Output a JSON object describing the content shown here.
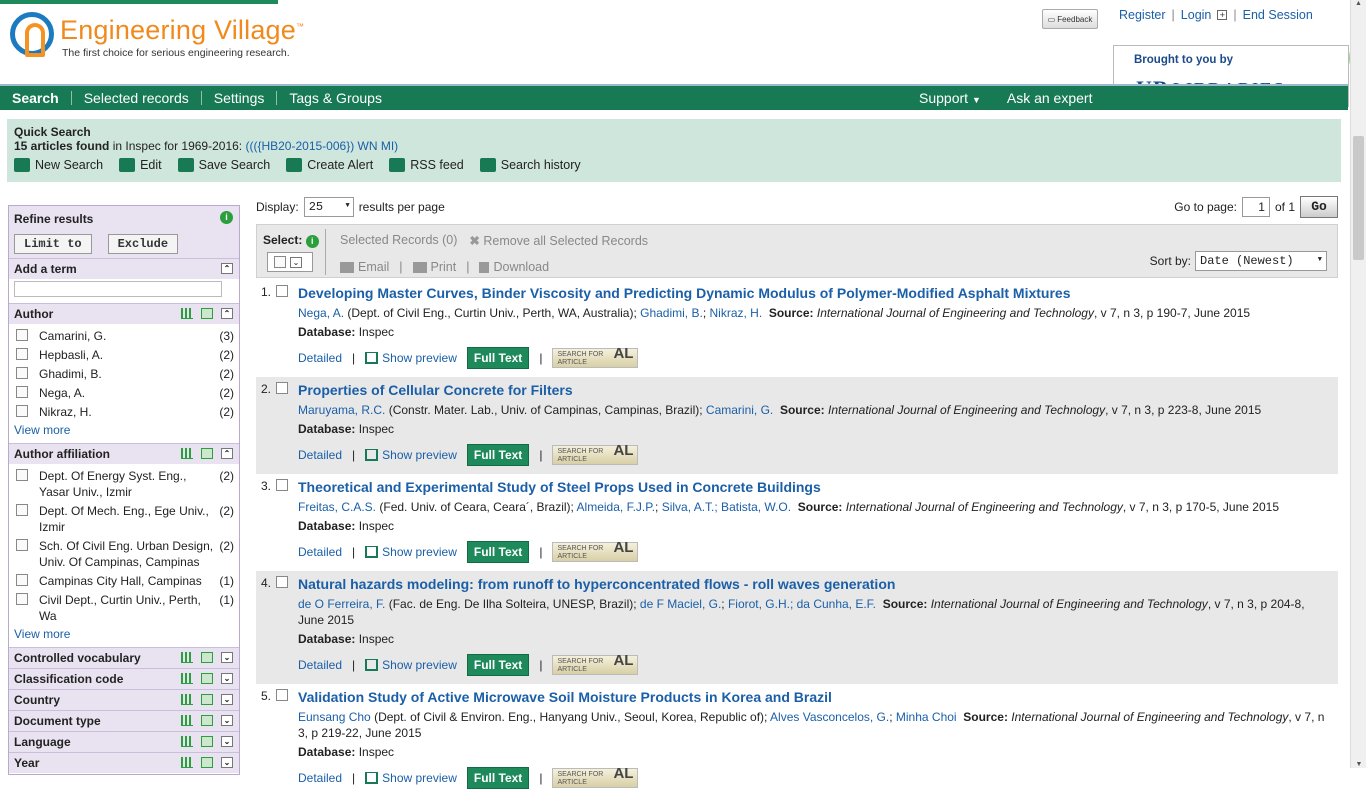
{
  "logo": {
    "title": "Engineering Village",
    "tm": "™",
    "tagline": "The first choice for serious engineering research."
  },
  "feedback": "Feedback",
  "toplinks": {
    "register": "Register",
    "login": "Login",
    "end": "End Session"
  },
  "brought": {
    "label": "Brought to you by",
    "lib": "LIBRARIES",
    "mark": "UB"
  },
  "ring": "65",
  "nav": {
    "items": [
      "Search",
      "Selected records",
      "Settings",
      "Tags & Groups"
    ],
    "support": "Support",
    "ask": "Ask an expert"
  },
  "quick": {
    "title": "Quick Search",
    "count": "15 articles found",
    "in": " in Inspec for 1969-2016: ",
    "query": "((({HB20-2015-006}) WN MI)",
    "tools": [
      "New Search",
      "Edit",
      "Save Search",
      "Create Alert",
      "RSS feed",
      "Search history"
    ]
  },
  "refine": {
    "title": "Refine results",
    "limit": "Limit to",
    "exclude": "Exclude",
    "addterm": "Add a term",
    "author": {
      "title": "Author",
      "items": [
        [
          "Camarini, G.",
          "(3)"
        ],
        [
          "Hepbasli, A.",
          "(2)"
        ],
        [
          "Ghadimi, B.",
          "(2)"
        ],
        [
          "Nega, A.",
          "(2)"
        ],
        [
          "Nikraz, H.",
          "(2)"
        ]
      ]
    },
    "affil": {
      "title": "Author affiliation",
      "items": [
        [
          "Dept. Of Energy Syst. Eng., Yasar Univ., Izmir",
          "(2)"
        ],
        [
          "Dept. Of Mech. Eng., Ege Univ., Izmir",
          "(2)"
        ],
        [
          "Sch. Of Civil Eng. Urban Design, Univ. Of Campinas, Campinas",
          "(2)"
        ],
        [
          "Campinas City Hall, Campinas",
          "(1)"
        ],
        [
          "Civil Dept., Curtin Univ., Perth, Wa",
          "(1)"
        ]
      ]
    },
    "viewmore": "View more",
    "collapsed": [
      "Controlled vocabulary",
      "Classification code",
      "Country",
      "Document type",
      "Language",
      "Year"
    ]
  },
  "display": {
    "label": "Display:",
    "value": "25",
    "suffix": "results per page"
  },
  "goto": {
    "label": "Go to page:",
    "page": "1",
    "of": "of 1",
    "go": "Go"
  },
  "selbar": {
    "select": "Select:",
    "selected": "Selected Records (0)",
    "removeall": "Remove all Selected Records",
    "email": "Email",
    "print": "Print",
    "download": "Download",
    "sortby": "Sort by:",
    "sortval": "Date (Newest)"
  },
  "results": [
    {
      "n": "1.",
      "title": "Developing Master Curves, Binder Viscosity and Predicting Dynamic Modulus of Polymer-Modified Asphalt Mixtures",
      "a1": "Nega, A.",
      "a1aff": " (Dept. of Civil Eng., Curtin Univ., Perth, WA, Australia); ",
      "a2": "Ghadimi, B.",
      "a3": "Nikraz, H.",
      "src": "International Journal of Engineering and Technology",
      "srcd": ", v 7, n 3, p 190-7, June 2015"
    },
    {
      "n": "2.",
      "title": "Properties of Cellular Concrete for Filters",
      "a1": "Maruyama, R.C.",
      "a1aff": " (Constr. Mater. Lab., Univ. of Campinas, Campinas, Brazil); ",
      "a2": "Camarini, G.",
      "a3": "",
      "src": "International Journal of Engineering and Technology",
      "srcd": ", v 7, n 3, p 223-8, June 2015"
    },
    {
      "n": "3.",
      "title": "Theoretical and Experimental Study of Steel Props Used in Concrete Buildings",
      "a1": "Freitas, C.A.S.",
      "a1aff": " (Fed. Univ. of Ceara, Ceara´, Brazil); ",
      "a2": "Almeida, F.J.P.",
      "a3": "Silva, A.T.; Batista, W.O.",
      "src": "International Journal of Engineering and Technology",
      "srcd": ", v 7, n 3, p 170-5, June 2015"
    },
    {
      "n": "4.",
      "title": "Natural hazards modeling: from runoff to hyperconcentrated flows - roll waves generation",
      "a1": "de O Ferreira, F.",
      "a1aff": " (Fac. de Eng. De Ilha Solteira, UNESP, Brazil); ",
      "a2": "de F Maciel, G.",
      "a3": "Fiorot, G.H.; da Cunha, E.F.",
      "src": "International Journal of Engineering and Technology",
      "srcd": ", v 7, n 3, p 204-8, June 2015"
    },
    {
      "n": "5.",
      "title": "Validation Study of Active Microwave Soil Moisture Products in Korea and Brazil",
      "a1": "Eunsang Cho",
      "a1aff": " (Dept. of Civil & Environ. Eng., Hanyang Univ., Seoul, Korea, Republic of); ",
      "a2": "Alves Vasconcelos, G.",
      "a3": "Minha Choi",
      "src": "International Journal of Engineering and Technology",
      "srcd": ", v 7, n 3, p 219-22, June 2015"
    }
  ],
  "labels": {
    "source": "Source:",
    "database": "Database:",
    "dbval": "Inspec",
    "detailed": "Detailed",
    "preview": "Show preview",
    "fulltext": "Full Text",
    "sfa1": "SEARCH FOR",
    "sfa2": "ARTICLE"
  }
}
